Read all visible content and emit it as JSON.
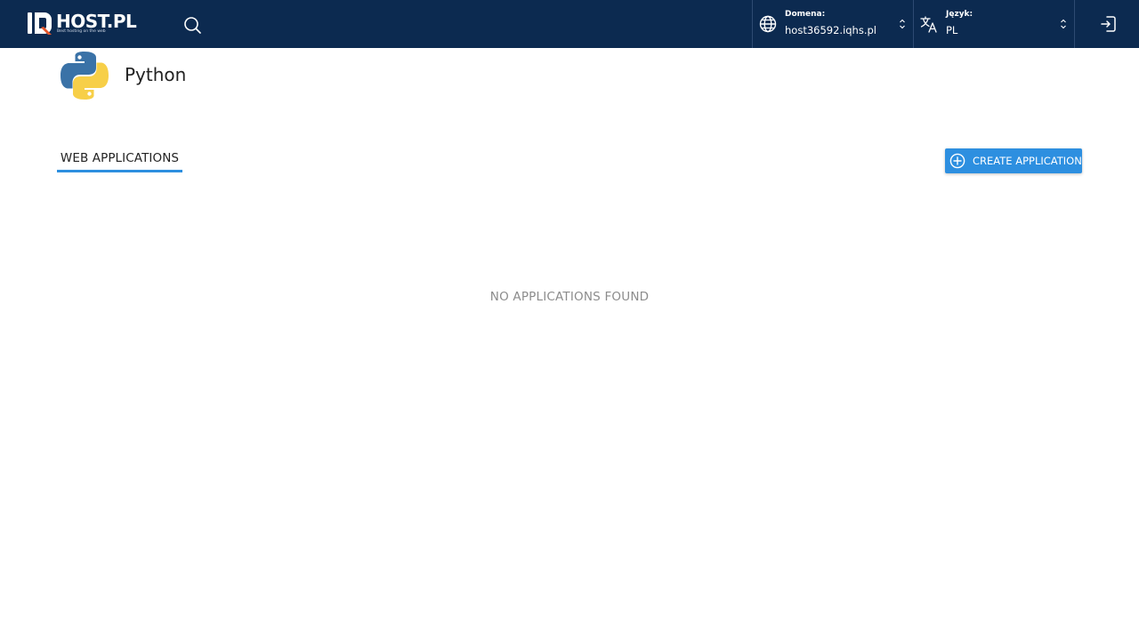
{
  "header": {
    "logo_text": "HOST.PL",
    "logo_tagline": "Best hosting on the web",
    "domain_selector": {
      "label": "Domena:",
      "value": "host36592.iqhs.pl"
    },
    "language_selector": {
      "label": "Język:",
      "value": "PL"
    }
  },
  "page": {
    "title": "Python"
  },
  "tabs": [
    {
      "label": "WEB APPLICATIONS",
      "active": true
    }
  ],
  "actions": {
    "create_label": "CREATE APPLICATION"
  },
  "empty_state": {
    "message": "NO APPLICATIONS FOUND"
  },
  "colors": {
    "topbar": "#0c2a50",
    "accent": "#2d8fe0",
    "logo_accent": "#e8562a",
    "muted_text": "#8c8c8c"
  },
  "icons": {
    "search": "search-icon",
    "domain": "globe-icon",
    "language": "translate-icon",
    "logout": "logout-icon",
    "create": "plus-circle-icon",
    "app": "python-logo"
  }
}
